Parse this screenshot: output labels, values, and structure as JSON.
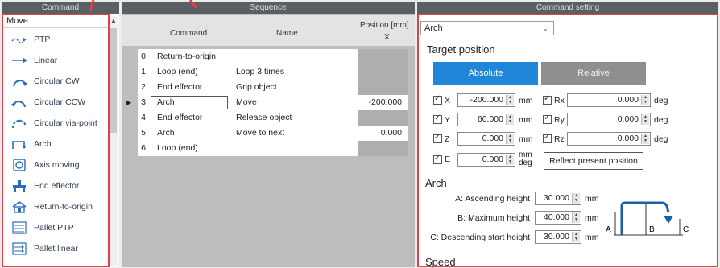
{
  "panels": {
    "command": "Command",
    "sequence": "Sequence",
    "setting": "Command setting"
  },
  "command_panel": {
    "category": "Move",
    "items": [
      {
        "label": "PTP",
        "icon": "ptp-icon"
      },
      {
        "label": "Linear",
        "icon": "linear-icon"
      },
      {
        "label": "Circular CW",
        "icon": "circular-cw-icon"
      },
      {
        "label": "Circular CCW",
        "icon": "circular-ccw-icon"
      },
      {
        "label": "Circular via-point",
        "icon": "circular-via-point-icon"
      },
      {
        "label": "Arch",
        "icon": "arch-icon"
      },
      {
        "label": "Axis moving",
        "icon": "axis-moving-icon"
      },
      {
        "label": "End effector",
        "icon": "end-effector-icon"
      },
      {
        "label": "Return-to-origin",
        "icon": "home-icon"
      },
      {
        "label": "Pallet PTP",
        "icon": "pallet-ptp-icon"
      },
      {
        "label": "Pallet linear",
        "icon": "pallet-linear-icon"
      }
    ]
  },
  "sequence": {
    "columns": {
      "command": "Command",
      "name": "Name",
      "position": "Position [mm]",
      "axis": "X"
    },
    "rows": [
      {
        "idx": "0",
        "command": "Return-to-origin",
        "name": "",
        "position": ""
      },
      {
        "idx": "1",
        "command": "Loop (end)",
        "name": "Loop 3 times",
        "position": ""
      },
      {
        "idx": "2",
        "command": "End effector",
        "name": "Grip object",
        "position": ""
      },
      {
        "idx": "3",
        "command": "Arch",
        "name": "Move",
        "position": "-200.000",
        "selected": true
      },
      {
        "idx": "4",
        "command": "End effector",
        "name": "Release object",
        "position": ""
      },
      {
        "idx": "5",
        "command": "Arch",
        "name": "Move to next",
        "position": "0.000"
      },
      {
        "idx": "6",
        "command": "Loop (end)",
        "name": "",
        "position": ""
      }
    ]
  },
  "setting": {
    "command_select": "Arch",
    "target_title": "Target position",
    "absolute_label": "Absolute",
    "relative_label": "Relative",
    "axes_left": [
      {
        "label": "X",
        "value": "-200.000",
        "unit": "mm"
      },
      {
        "label": "Y",
        "value": "60.000",
        "unit": "mm"
      },
      {
        "label": "Z",
        "value": "0.000",
        "unit": "mm"
      },
      {
        "label": "E",
        "value": "0.000",
        "unit": "mm\ndeg"
      }
    ],
    "axes_right": [
      {
        "label": "Rx",
        "value": "0.000",
        "unit": "deg"
      },
      {
        "label": "Ry",
        "value": "0.000",
        "unit": "deg"
      },
      {
        "label": "Rz",
        "value": "0.000",
        "unit": "deg"
      }
    ],
    "reflect_label": "Reflect present position",
    "arch_title": "Arch",
    "arch_params": [
      {
        "label": "A:  Ascending height",
        "value": "30.000",
        "unit": "mm"
      },
      {
        "label": "B:  Maximum height",
        "value": "40.000",
        "unit": "mm"
      },
      {
        "label": "C:  Descending start height",
        "value": "30.000",
        "unit": "mm"
      }
    ],
    "diagram_labels": {
      "a": "A",
      "b": "B",
      "c": "C"
    },
    "speed_title": "Speed"
  },
  "colors": {
    "header_bg": "#5a5f63",
    "highlight": "#e0414b",
    "absolute_bg": "#1f86d9",
    "relative_bg": "#8f8f8f"
  }
}
